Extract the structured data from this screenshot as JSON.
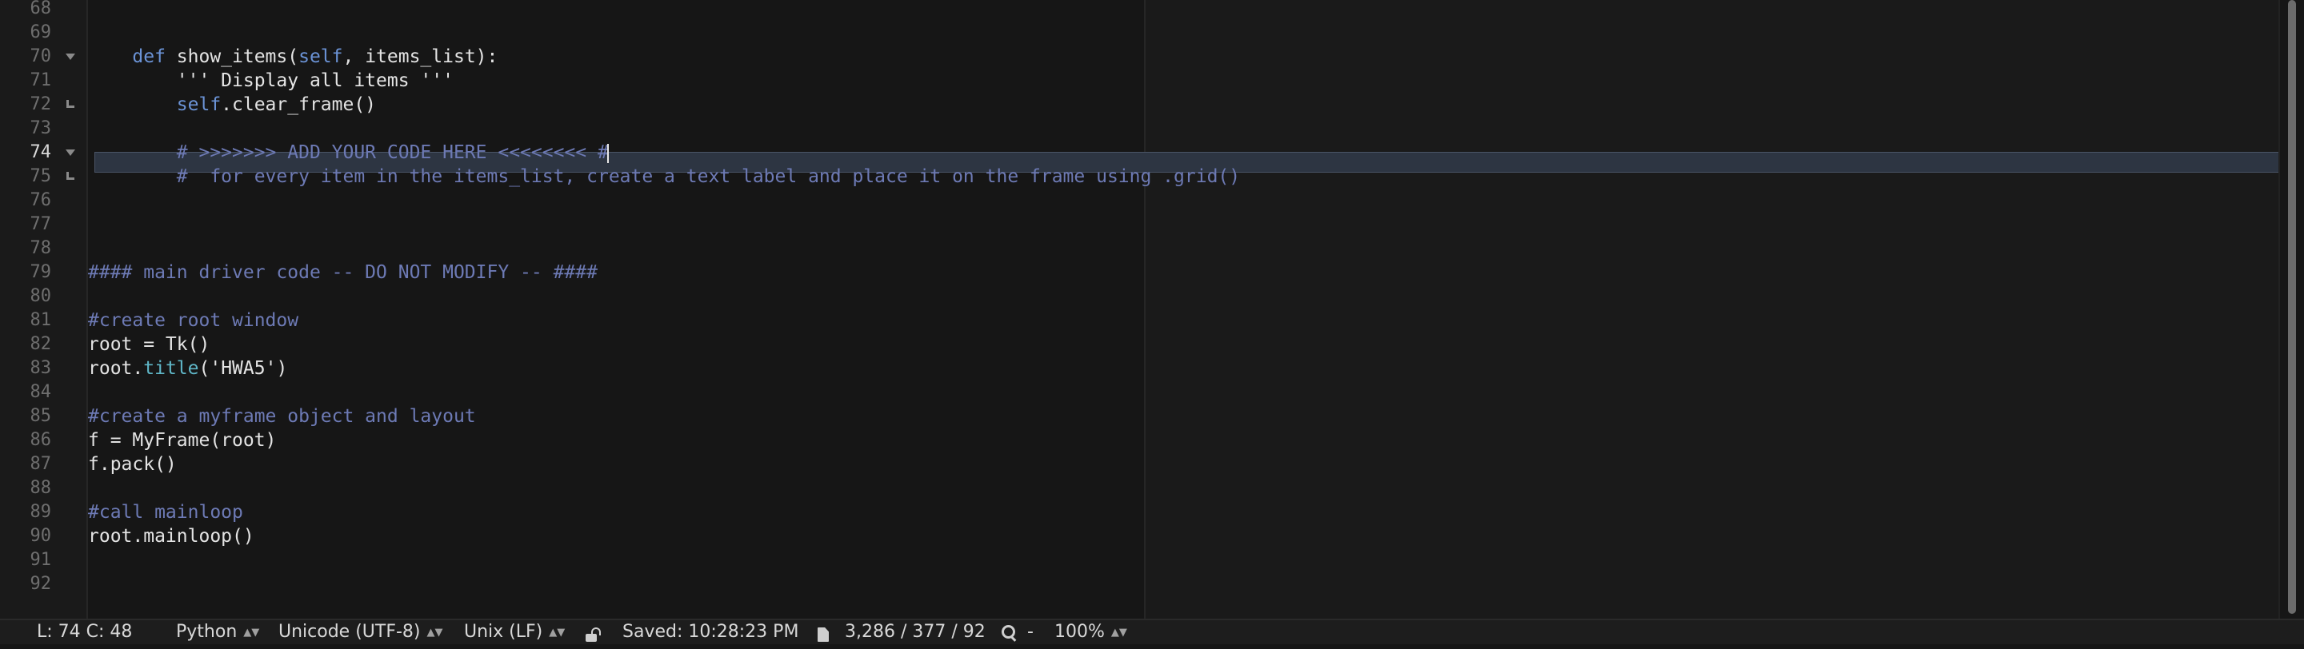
{
  "editor": {
    "lines": [
      {
        "num": "68",
        "fold": "",
        "tokens": []
      },
      {
        "num": "69",
        "fold": "",
        "tokens": []
      },
      {
        "num": "70",
        "fold": "open",
        "tokens": [
          {
            "t": "    ",
            "c": ""
          },
          {
            "t": "def",
            "c": "kw"
          },
          {
            "t": " show_items(",
            "c": "fn"
          },
          {
            "t": "self",
            "c": "self"
          },
          {
            "t": ", items_list):",
            "c": "fn"
          }
        ]
      },
      {
        "num": "71",
        "fold": "",
        "tokens": [
          {
            "t": "        ''' Display all items '''",
            "c": "strlit"
          }
        ]
      },
      {
        "num": "72",
        "fold": "end",
        "tokens": [
          {
            "t": "        ",
            "c": ""
          },
          {
            "t": "self",
            "c": "self"
          },
          {
            "t": ".clear_frame()",
            "c": "fn"
          }
        ]
      },
      {
        "num": "73",
        "fold": "",
        "tokens": []
      },
      {
        "num": "74",
        "fold": "open",
        "current": true,
        "tokens": [
          {
            "t": "        # >>>>>>> ADD YOUR CODE HERE <<<<<<<< #",
            "c": "cm"
          }
        ]
      },
      {
        "num": "75",
        "fold": "end",
        "tokens": [
          {
            "t": "        #  for every item in the items_list, create a text label and place it on the frame using .grid()",
            "c": "cm"
          }
        ]
      },
      {
        "num": "76",
        "fold": "",
        "tokens": []
      },
      {
        "num": "77",
        "fold": "",
        "tokens": []
      },
      {
        "num": "78",
        "fold": "",
        "tokens": []
      },
      {
        "num": "79",
        "fold": "",
        "tokens": [
          {
            "t": "#### main driver code -- DO NOT MODIFY -- ####",
            "c": "cm"
          }
        ]
      },
      {
        "num": "80",
        "fold": "",
        "tokens": []
      },
      {
        "num": "81",
        "fold": "",
        "tokens": [
          {
            "t": "#create root window",
            "c": "cm"
          }
        ]
      },
      {
        "num": "82",
        "fold": "",
        "tokens": [
          {
            "t": "root = Tk()",
            "c": "fn"
          }
        ]
      },
      {
        "num": "83",
        "fold": "",
        "tokens": [
          {
            "t": "root.",
            "c": "fn"
          },
          {
            "t": "title",
            "c": "builtin"
          },
          {
            "t": "(",
            "c": "fn"
          },
          {
            "t": "'HWA5'",
            "c": "strlit"
          },
          {
            "t": ")",
            "c": "fn"
          }
        ]
      },
      {
        "num": "84",
        "fold": "",
        "tokens": []
      },
      {
        "num": "85",
        "fold": "",
        "tokens": [
          {
            "t": "#create a myframe object and layout",
            "c": "cm"
          }
        ]
      },
      {
        "num": "86",
        "fold": "",
        "tokens": [
          {
            "t": "f = MyFrame(root)",
            "c": "fn"
          }
        ]
      },
      {
        "num": "87",
        "fold": "",
        "tokens": [
          {
            "t": "f.pack()",
            "c": "fn"
          }
        ]
      },
      {
        "num": "88",
        "fold": "",
        "tokens": []
      },
      {
        "num": "89",
        "fold": "",
        "tokens": [
          {
            "t": "#call mainloop",
            "c": "cm"
          }
        ]
      },
      {
        "num": "90",
        "fold": "",
        "tokens": [
          {
            "t": "root.mainloop()",
            "c": "fn"
          }
        ]
      },
      {
        "num": "91",
        "fold": "",
        "tokens": []
      },
      {
        "num": "92",
        "fold": "",
        "tokens": []
      }
    ]
  },
  "status": {
    "position": "L: 74 C: 48",
    "language": "Python",
    "encoding": "Unicode (UTF-8)",
    "line_endings": "Unix (LF)",
    "saved": "Saved: 10:28:23 PM",
    "doc_stats": "3,286 / 377 / 92",
    "search_value": "-",
    "zoom": "100%"
  },
  "colors": {
    "background": "#161616",
    "comment": "#6d7ab5",
    "keyword": "#6b93d6",
    "current_line": "#2d3542"
  },
  "icons": [
    "chevron-updown-icon",
    "lock-icon",
    "document-icon",
    "search-icon",
    "fold-arrow-icon"
  ]
}
